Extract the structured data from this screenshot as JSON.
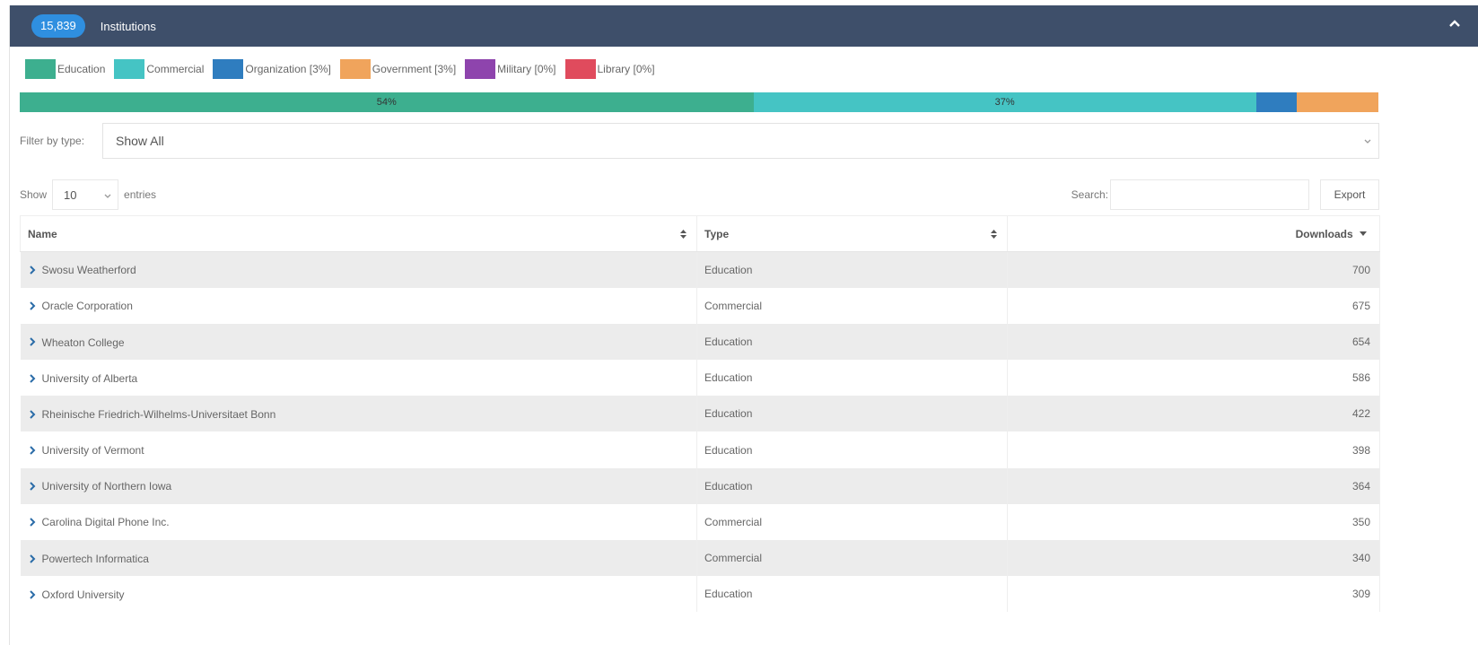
{
  "header": {
    "count": "15,839",
    "title": "Institutions"
  },
  "legend": [
    {
      "label": "Education",
      "color": "#3daf8f"
    },
    {
      "label": "Commercial",
      "color": "#45c4c4"
    },
    {
      "label": "Organization [3%]",
      "color": "#2f7dbf"
    },
    {
      "label": "Government [3%]",
      "color": "#f0a45c"
    },
    {
      "label": "Military [0%]",
      "color": "#8e44ad"
    },
    {
      "label": "Library [0%]",
      "color": "#e04b5d"
    }
  ],
  "distribution": [
    {
      "type": "Education",
      "percent": 54,
      "label": "54%",
      "color": "#3daf8f"
    },
    {
      "type": "Commercial",
      "percent": 37,
      "label": "37%",
      "color": "#45c4c4"
    },
    {
      "type": "Organization",
      "percent": 3,
      "label": "",
      "color": "#2f7dbf"
    },
    {
      "type": "Government",
      "percent": 3,
      "label": "",
      "color": "#f0a45c"
    }
  ],
  "filter": {
    "label": "Filter by type:",
    "value": "Show All"
  },
  "controls": {
    "show_label": "Show",
    "entries_value": "10",
    "entries_label": "entries",
    "search_label": "Search:",
    "search_value": "",
    "export_label": "Export"
  },
  "table": {
    "columns": [
      "Name",
      "Type",
      "Downloads"
    ],
    "rows": [
      {
        "name": "Swosu Weatherford",
        "type": "Education",
        "downloads": "700"
      },
      {
        "name": "Oracle Corporation",
        "type": "Commercial",
        "downloads": "675"
      },
      {
        "name": "Wheaton College",
        "type": "Education",
        "downloads": "654"
      },
      {
        "name": "University of Alberta",
        "type": "Education",
        "downloads": "586"
      },
      {
        "name": "Rheinische Friedrich-Wilhelms-Universitaet Bonn",
        "type": "Education",
        "downloads": "422"
      },
      {
        "name": "University of Vermont",
        "type": "Education",
        "downloads": "398"
      },
      {
        "name": "University of Northern Iowa",
        "type": "Education",
        "downloads": "364"
      },
      {
        "name": "Carolina Digital Phone Inc.",
        "type": "Commercial",
        "downloads": "350"
      },
      {
        "name": "Powertech Informatica",
        "type": "Commercial",
        "downloads": "340"
      },
      {
        "name": "Oxford University",
        "type": "Education",
        "downloads": "309"
      }
    ]
  },
  "colors": {
    "header_bg": "#3e4f6a",
    "badge_bg": "#2f8fe0",
    "row_chevron": "#2b6ca8"
  }
}
